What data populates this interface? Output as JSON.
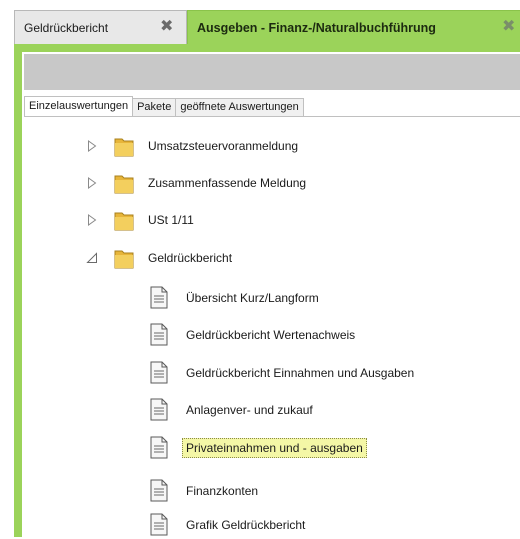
{
  "tabs": [
    {
      "label": "Geldrückbericht",
      "active": false
    },
    {
      "label": "Ausgeben - Finanz-/Naturalbuchführung",
      "active": true
    }
  ],
  "colors": {
    "accent_green": "#9bd35a",
    "toolbar_gray": "#c8c8c8",
    "highlight": "#f4f7a6"
  },
  "subtabs": [
    {
      "label": "Einzelauswertungen",
      "selected": true
    },
    {
      "label": "Pakete",
      "selected": false
    },
    {
      "label": "geöffnete Auswertungen",
      "selected": false
    }
  ],
  "tree": {
    "folders": [
      {
        "label": "Umsatzsteuervoranmeldung",
        "expanded": false
      },
      {
        "label": "Zusammenfassende Meldung",
        "expanded": false
      },
      {
        "label": "USt 1/11",
        "expanded": false
      },
      {
        "label": "Geldrückbericht",
        "expanded": true
      }
    ],
    "reports": [
      {
        "label": "Übersicht Kurz/Langform"
      },
      {
        "label": "Geldrückbericht Wertenachweis"
      },
      {
        "label": "Geldrückbericht Einnahmen und Ausgaben"
      },
      {
        "label": "Anlagenver- und zukauf"
      },
      {
        "label": "Privateinnahmen und - ausgaben",
        "selected": true
      },
      {
        "label": "Finanzkonten"
      },
      {
        "label": "Grafik Geldrückbericht"
      }
    ]
  },
  "icons": {
    "collapsed": "triangle-right-icon",
    "expanded": "triangle-down-icon",
    "folder": "folder-icon",
    "report": "document-icon",
    "close": "close-icon"
  }
}
